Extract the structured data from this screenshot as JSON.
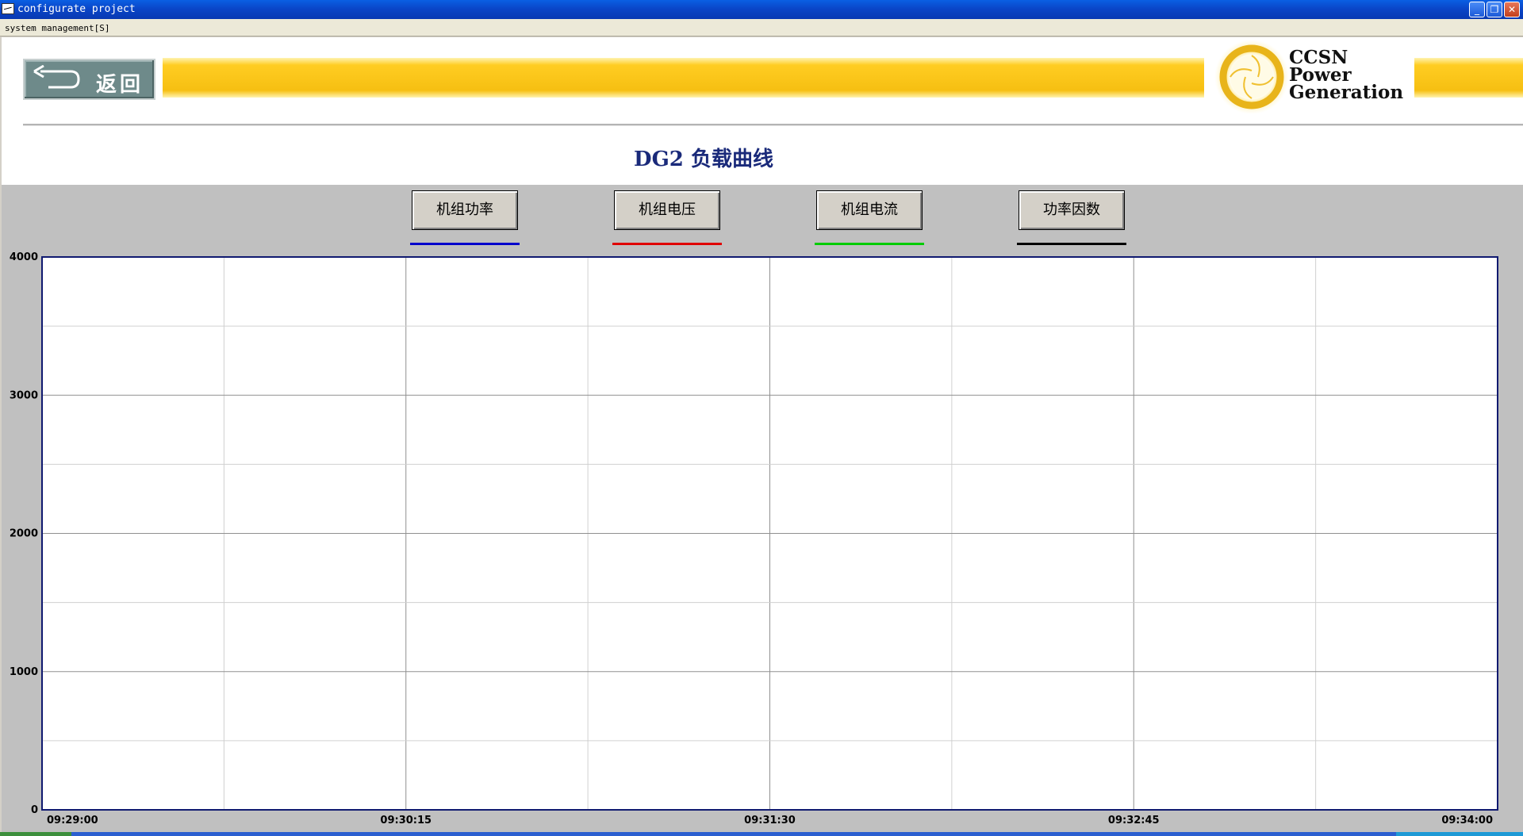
{
  "window": {
    "title": "configurate project",
    "minimize_glyph": "_",
    "restore_glyph": "❐",
    "close_glyph": "✕"
  },
  "menu": {
    "items": [
      "system management[S]"
    ]
  },
  "header": {
    "back_label": "返回",
    "logo_lines": [
      "CCSN",
      "Power",
      "Generation"
    ],
    "page_title": "DG2 负载曲线"
  },
  "series_buttons": [
    {
      "label": "机组功率",
      "color": "#0000cc"
    },
    {
      "label": "机组电压",
      "color": "#e00000"
    },
    {
      "label": "机组电流",
      "color": "#00cc00"
    },
    {
      "label": "功率因数",
      "color": "#000000"
    }
  ],
  "chart_data": {
    "type": "line",
    "title": "DG2 负载曲线",
    "xlabel": "",
    "ylabel": "",
    "ylim": [
      0,
      4000
    ],
    "y_ticks": [
      "4000",
      "3000",
      "2000",
      "1000",
      "0"
    ],
    "x_ticks": [
      "09:29:00",
      "09:30:15",
      "09:31:30",
      "09:32:45",
      "09:34:00"
    ],
    "grid": true,
    "series": [
      {
        "name": "机组功率",
        "color": "#0000cc",
        "values": []
      },
      {
        "name": "机组电压",
        "color": "#e00000",
        "values": []
      },
      {
        "name": "机组电流",
        "color": "#00cc00",
        "values": []
      },
      {
        "name": "功率因数",
        "color": "#000000",
        "values": []
      }
    ]
  },
  "icons": {
    "back": "return-arrow-icon",
    "logo": "sun-logo-icon",
    "app": "window-app-icon"
  }
}
